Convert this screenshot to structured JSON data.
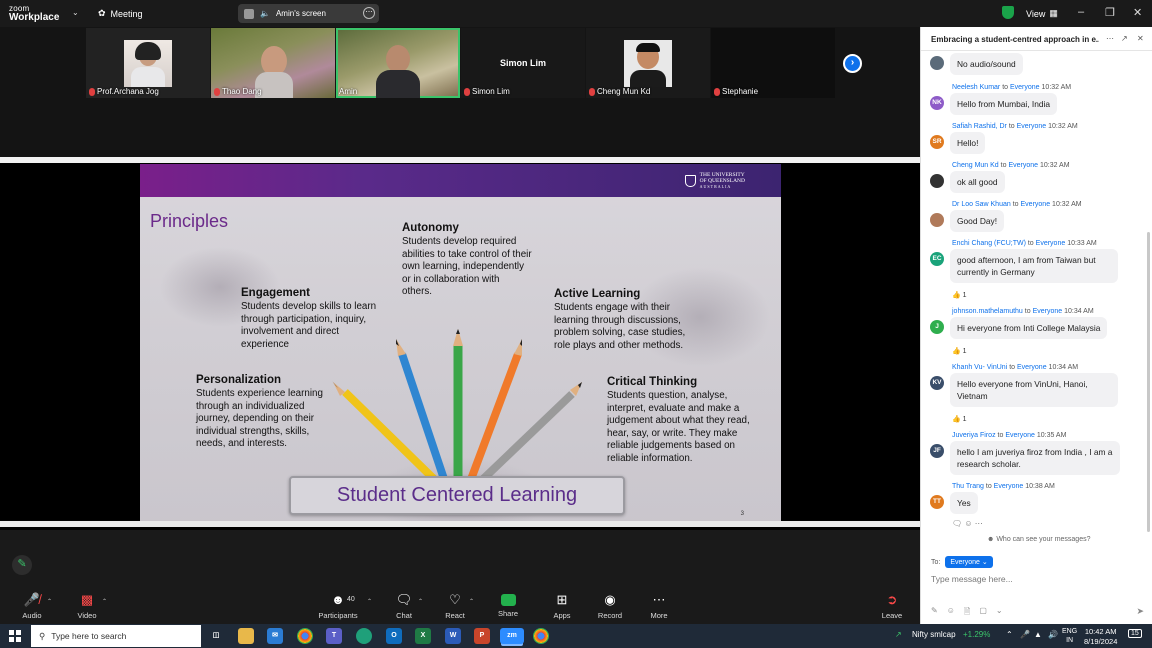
{
  "app": {
    "brand_small": "zoom",
    "brand_big": "Workplace",
    "meeting_label": "Meeting",
    "share_label": "Amin's screen",
    "view_label": "View"
  },
  "participants": [
    {
      "name": "Prof.Archana Jog"
    },
    {
      "name": "Thao Dang"
    },
    {
      "name": "Amin"
    },
    {
      "name": "Simon Lim",
      "center": "Simon Lim"
    },
    {
      "name": "Cheng Mun Kd"
    },
    {
      "name": "Stephanie"
    }
  ],
  "slide": {
    "title": "Principles",
    "uq_line1": "THE UNIVERSITY",
    "uq_line2": "OF QUEENSLAND",
    "uq_line3": "AUSTRALIA",
    "autonomy": {
      "h": "Autonomy",
      "p": "Students develop required abilities to take control of their own learning, independently or in collaboration with others."
    },
    "engagement": {
      "h": "Engagement",
      "p": "Students develop skills to learn through participation, inquiry, involvement and direct experience"
    },
    "active": {
      "h": "Active Learning",
      "p": "Students engage with their learning through discussions, problem solving, case studies, role plays and other methods."
    },
    "personalization": {
      "h": "Personalization",
      "p": "Students experience learning through an individualized journey, depending on their individual strengths, skills, needs, and interests."
    },
    "critical": {
      "h": "Critical Thinking",
      "p": "Students question, analyse, interpret, evaluate and make a judgement about what they read, hear, say, or write. They make reliable judgements based on reliable information."
    },
    "banner": "Student Centered Learning",
    "page": "3"
  },
  "toolbar": {
    "audio": "Audio",
    "video": "Video",
    "participants": "Participants",
    "participants_count": "40",
    "chat": "Chat",
    "react": "React",
    "share": "Share",
    "apps": "Apps",
    "record": "Record",
    "more": "More",
    "leave": "Leave"
  },
  "chat": {
    "title": "Embracing a student-centred approach in e...",
    "to_label": "To:",
    "to_value": "Everyone",
    "placeholder": "Type message here...",
    "who_can_see": "Who can see your messages?",
    "messages": [
      {
        "initials": "",
        "color": "#5b6b7a",
        "sender": "",
        "to": "",
        "time": "",
        "text": "No audio/sound"
      },
      {
        "initials": "NK",
        "color": "#8e5cc8",
        "sender": "Neelesh Kumar",
        "to": "to",
        "everyone": "Everyone",
        "time": "10:32 AM",
        "text": "Hello from Mumbai, India"
      },
      {
        "initials": "SR",
        "color": "#e07a1f",
        "sender": "Safiah Rashid, Dr",
        "to": "to",
        "everyone": "Everyone",
        "time": "10:32 AM",
        "text": "Hello!"
      },
      {
        "initials": "",
        "color": "#333333",
        "sender": "Cheng Mun Kd",
        "to": "to",
        "everyone": "Everyone",
        "time": "10:32 AM",
        "text": "ok all good"
      },
      {
        "initials": "",
        "color": "#b07a5a",
        "sender": "Dr Loo Saw Khuan",
        "to": "to",
        "everyone": "Everyone",
        "time": "10:32 AM",
        "text": "Good Day!"
      },
      {
        "initials": "EC",
        "color": "#1aa37a",
        "sender": "Enchi Chang (FCU;TW)",
        "to": "to",
        "everyone": "Everyone",
        "time": "10:33 AM",
        "text": "good afternoon, I am from Taiwan but currently in Germany",
        "reaction": "1"
      },
      {
        "initials": "J",
        "color": "#2fae4e",
        "sender": "johnson.mathelamuthu",
        "to": "to",
        "everyone": "Everyone",
        "time": "10:34 AM",
        "text": "Hi everyone from Inti College Malaysia",
        "reaction": "1"
      },
      {
        "initials": "KV",
        "color": "#3a4e6a",
        "sender": "Khanh Vu- VinUni",
        "to": "to",
        "everyone": "Everyone",
        "time": "10:34 AM",
        "text": "Hello everyone from VinUni, Hanoi, Vietnam",
        "reaction": "1"
      },
      {
        "initials": "JF",
        "color": "#3a4e6a",
        "sender": "Juveriya Firoz",
        "to": "to",
        "everyone": "Everyone",
        "time": "10:35 AM",
        "text": "hello I am juveriya firoz from India , I am a research scholar."
      },
      {
        "initials": "TT",
        "color": "#e07a1f",
        "sender": "Thu Trang",
        "to": "to",
        "everyone": "Everyone",
        "time": "10:38 AM",
        "text": "Yes"
      }
    ]
  },
  "taskbar": {
    "search_placeholder": "Type here to search",
    "ticker_name": "Nifty smlcap",
    "ticker_change": "+1.29%",
    "lang1": "ENG",
    "lang2": "IN",
    "time": "10:42 AM",
    "date": "8/19/2024",
    "notif": "15"
  }
}
